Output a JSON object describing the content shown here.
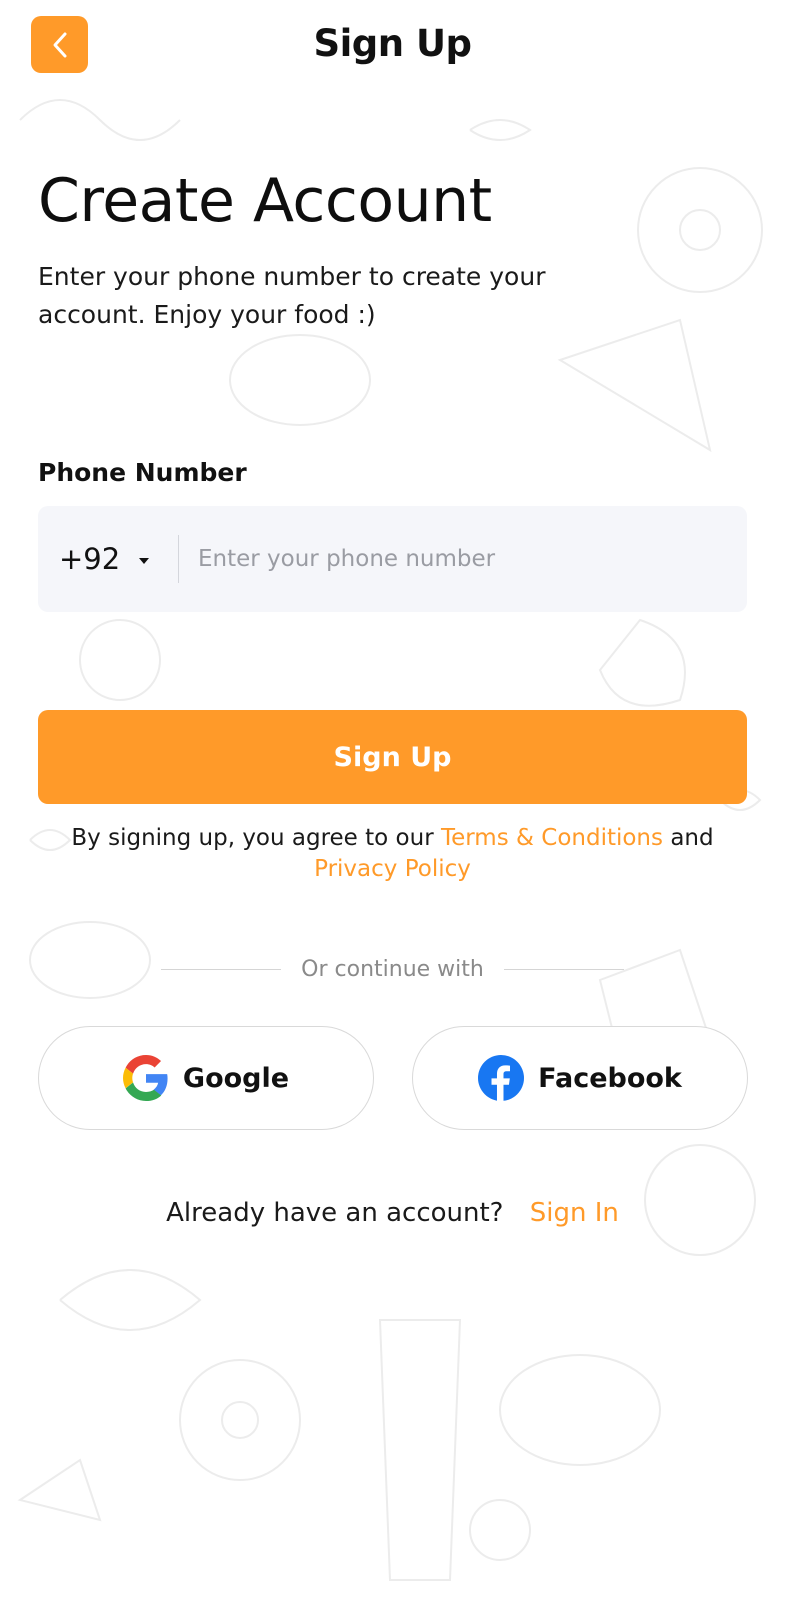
{
  "header": {
    "title": "Sign Up"
  },
  "intro": {
    "headline": "Create Account",
    "description": "Enter your phone number to create your account. Enjoy your food :)"
  },
  "phone": {
    "label": "Phone Number",
    "country_code": "+92",
    "placeholder": "Enter your phone number",
    "value": ""
  },
  "actions": {
    "signup_label": "Sign Up"
  },
  "terms": {
    "prefix": "By signing up, you agree to our",
    "terms_link": "Terms & Conditions",
    "conjunction": "and",
    "privacy_link": "Privacy Policy"
  },
  "social": {
    "divider_text": "Or continue with",
    "google_label": "Google",
    "facebook_label": "Facebook"
  },
  "footer": {
    "question": "Already have an account?",
    "signin_label": "Sign In"
  },
  "colors": {
    "accent": "#FF9A29",
    "input_bg": "#F5F6FA",
    "facebook_blue": "#1877F2"
  },
  "icons": {
    "back": "chevron-left-icon",
    "dropdown": "caret-down-icon",
    "google": "google-icon",
    "facebook": "facebook-icon"
  }
}
